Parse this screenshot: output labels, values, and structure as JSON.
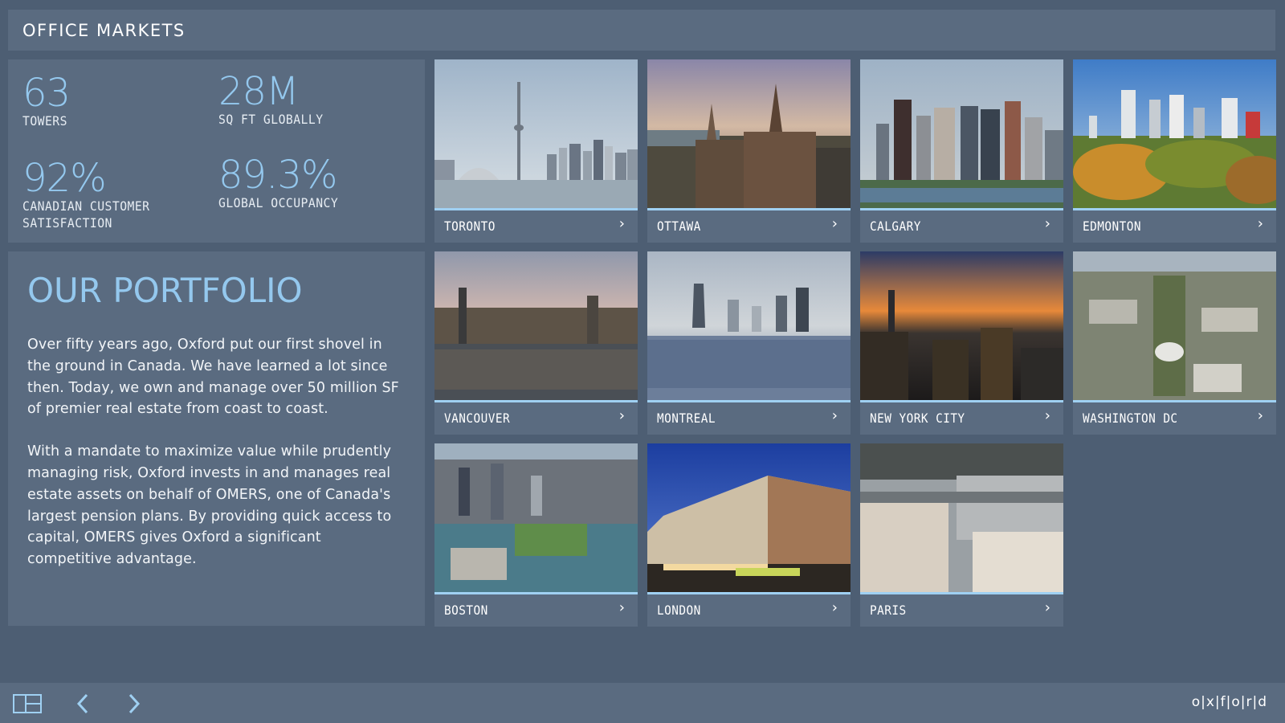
{
  "header": {
    "title": "OFFICE MARKETS"
  },
  "stats": [
    {
      "value": "63",
      "label": "TOWERS"
    },
    {
      "value": "28M",
      "label": "SQ FT GLOBALLY"
    },
    {
      "value": "92%",
      "label_line1": "CANADIAN CUSTOMER",
      "label_line2": "SATISFACTION"
    },
    {
      "value": "89.3%",
      "label": "GLOBAL OCCUPANCY"
    }
  ],
  "portfolio": {
    "title": "OUR PORTFOLIO",
    "paragraph1": "Over fifty years ago, Oxford put our first shovel in the ground in Canada. We have learned a lot since then. Today, we own and manage over 50 million SF of premier real estate from coast to coast.",
    "paragraph2": "With a mandate to maximize value while prudently managing risk, Oxford invests in and manages real estate assets on behalf of OMERS, one of Canada's largest pension plans. By providing quick access to capital, OMERS gives Oxford a significant competitive advantage."
  },
  "cities": [
    {
      "name": "TORONTO"
    },
    {
      "name": "OTTAWA"
    },
    {
      "name": "CALGARY"
    },
    {
      "name": "EDMONTON"
    },
    {
      "name": "VANCOUVER"
    },
    {
      "name": "MONTREAL"
    },
    {
      "name": "NEW YORK CITY"
    },
    {
      "name": "WASHINGTON DC"
    },
    {
      "name": "BOSTON"
    },
    {
      "name": "LONDON"
    },
    {
      "name": "PARIS"
    }
  ],
  "footer": {
    "logo": "o|x|f|o|r|d",
    "icons": [
      "layout-icon",
      "arrow-left-icon",
      "arrow-right-icon"
    ]
  },
  "colors": {
    "background": "#4d5e73",
    "panel": "#5a6b80",
    "accent": "#94c8ee",
    "card_bar": "#9fd0f2"
  }
}
